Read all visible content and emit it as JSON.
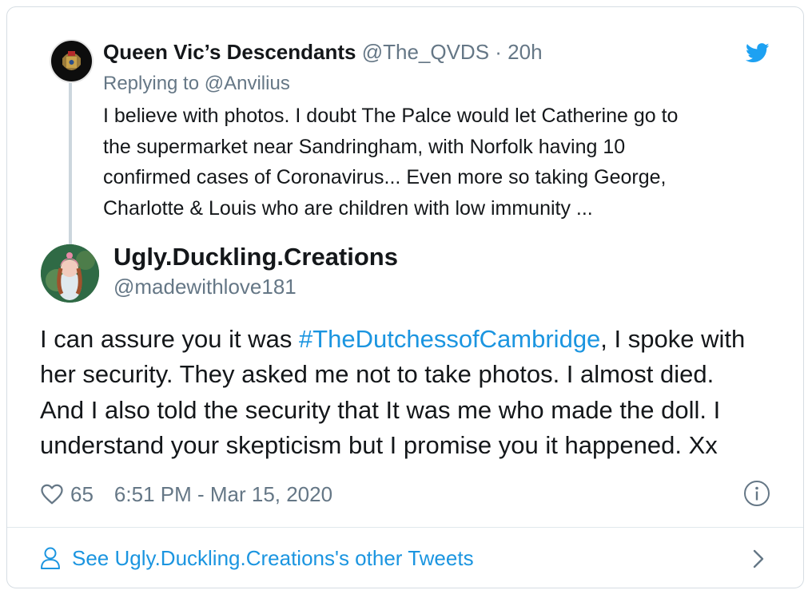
{
  "reply_tweet": {
    "display_name": "Queen Vic’s Descendants",
    "handle_time": "@The_QVDS · 20h",
    "replying_label": "Replying to",
    "replying_to": "@Anvilius",
    "lines": [
      "I believe with photos.  I doubt The Palce would let Catherine go to",
      "the supermarket near Sandringham, with Norfolk having 10",
      "confirmed cases of Coronavirus... Even more so taking George,",
      "Charlotte & Louis who are children with low immunity ..."
    ]
  },
  "main_tweet": {
    "display_name": "Ugly.Duckling.Creations",
    "handle": "@madewithlove181",
    "line1_before": "I can assure you it was ",
    "hashtag": "#TheDutchessofCambridge",
    "line1_after": ", I spoke with",
    "lines_rest": [
      "her security. They asked me not to take photos. I almost died.",
      "And I also told the security that It was me who made the doll. I",
      "understand your skepticism but I promise you it happened. Xx"
    ],
    "likes": "65",
    "timestamp": "6:51 PM - Mar 15, 2020"
  },
  "footer": {
    "label": "See Ugly.Duckling.Creations's other Tweets"
  },
  "colors": {
    "link": "#1b95e0",
    "secondary_text": "#657786",
    "twitter_blue": "#1da1f2"
  },
  "icons": [
    "twitter-bird-icon",
    "heart-icon",
    "info-icon",
    "person-icon",
    "chevron-right-icon"
  ]
}
